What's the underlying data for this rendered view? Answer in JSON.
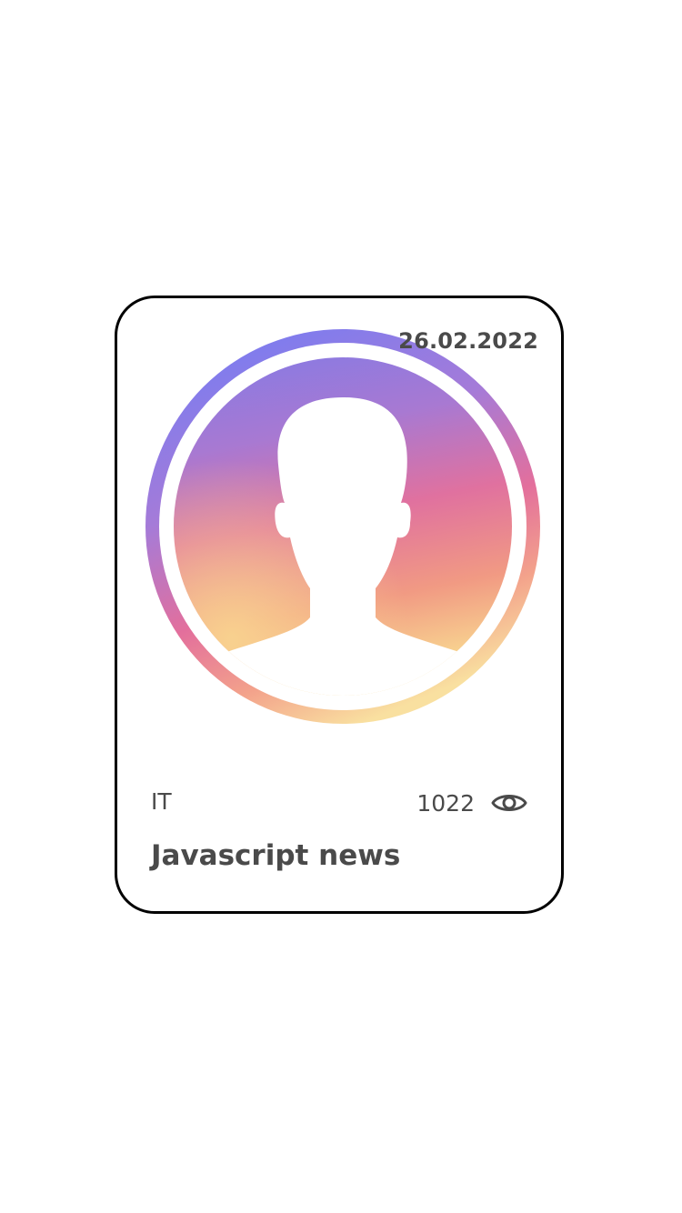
{
  "card": {
    "date": "26.02.2022",
    "category": "IT",
    "views": "1022",
    "title": "Javascript news",
    "avatar_icon": "user-silhouette-icon",
    "views_icon": "eye-icon"
  },
  "colors": {
    "text": "#4a4a4a",
    "card_border": "#000000",
    "gradient": [
      "#7b78ec",
      "#9a76dc",
      "#e06b9e",
      "#f19884",
      "#f8d58f"
    ]
  }
}
